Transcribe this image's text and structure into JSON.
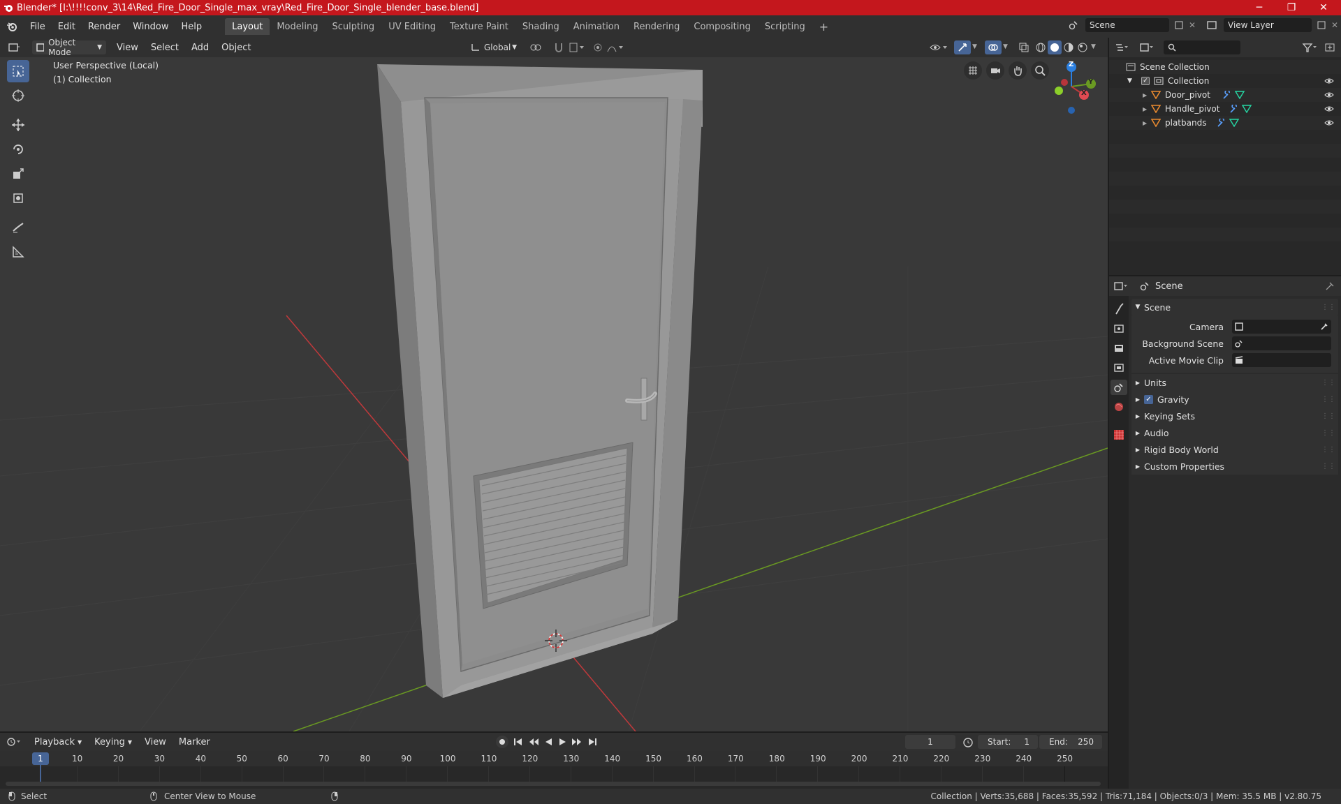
{
  "window": {
    "title": "Blender* [I:\\!!!!conv_3\\14\\Red_Fire_Door_Single_max_vray\\Red_Fire_Door_Single_blender_base.blend]",
    "minimize": "─",
    "maximize": "❐",
    "close": "✕"
  },
  "menus": [
    "File",
    "Edit",
    "Render",
    "Window",
    "Help"
  ],
  "workspaces": [
    "Layout",
    "Modeling",
    "Sculpting",
    "UV Editing",
    "Texture Paint",
    "Shading",
    "Animation",
    "Rendering",
    "Compositing",
    "Scripting"
  ],
  "add_workspace": "+",
  "scene_selector": "Scene",
  "view_layer": "View Layer",
  "viewport_header": {
    "mode": "Object Mode",
    "menus": [
      "View",
      "Select",
      "Add",
      "Object"
    ],
    "transform_orientation": "Global"
  },
  "viewport": {
    "overlay_line1": "User Perspective (Local)",
    "overlay_line2": "(1) Collection",
    "gizmo": {
      "x": "X",
      "y": "Y",
      "z": "Z"
    }
  },
  "outliner": {
    "root": "Scene Collection",
    "collection": "Collection",
    "objects": [
      "Door_pivot",
      "Handle_pivot",
      "platbands"
    ]
  },
  "properties": {
    "header": "Scene",
    "panel_title": "Scene",
    "fields": [
      {
        "label": "Camera",
        "value": ""
      },
      {
        "label": "Background Scene",
        "value": ""
      },
      {
        "label": "Active Movie Clip",
        "value": ""
      }
    ],
    "panels": [
      "Units",
      "Gravity",
      "Keying Sets",
      "Audio",
      "Rigid Body World",
      "Custom Properties"
    ]
  },
  "timeline": {
    "menus": [
      "Playback",
      "Keying",
      "View",
      "Marker"
    ],
    "current_frame": "1",
    "start_label": "Start:",
    "start": "1",
    "end_label": "End:",
    "end": "250",
    "ruler_current": "1",
    "ticks": [
      "10",
      "20",
      "30",
      "40",
      "50",
      "60",
      "70",
      "80",
      "90",
      "100",
      "110",
      "120",
      "130",
      "140",
      "150",
      "160",
      "170",
      "180",
      "190",
      "200",
      "210",
      "220",
      "230",
      "240",
      "250"
    ]
  },
  "statusbar": {
    "left1": "Select",
    "left2": "Center View to Mouse",
    "right": "Collection | Verts:35,688 | Faces:35,592 | Tris:71,184 | Objects:0/3 | Mem: 35.5 MB | v2.80.75"
  },
  "colors": {
    "titlebar": "#c4171d",
    "accent": "#476596",
    "viewport_bg": "#393939",
    "x_axis": "#c0393b",
    "y_axis": "#6a9a22",
    "z_axis": "#2b7fe0"
  }
}
